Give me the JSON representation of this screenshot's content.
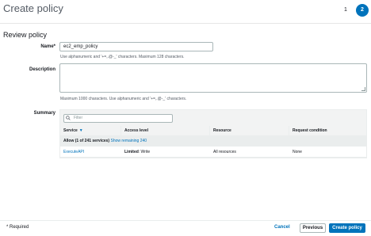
{
  "header": {
    "title": "Create policy",
    "steps": [
      "1",
      "2"
    ]
  },
  "review": {
    "section_title": "Review policy",
    "name_label": "Name*",
    "name_value": "ec2_emp_policy",
    "name_hint": "Use alphanumeric and '+=,.@-_' characters. Maximum 128 characters.",
    "description_label": "Description",
    "description_value": "",
    "description_hint": "Maximum 1000 characters. Use alphanumeric and '+=,.@-_' characters.",
    "summary_label": "Summary"
  },
  "summary": {
    "filter_placeholder": "Filter",
    "columns": [
      "Service",
      "Access level",
      "Resource",
      "Request condition"
    ],
    "group_text": "Allow (1 of 241 services)",
    "group_link": "Show remaining 240",
    "rows": [
      {
        "service": "ExecuteAPI",
        "access_level_bold": "Limited",
        "access_level_rest": ": Write",
        "resource": "All resources",
        "condition": "None"
      }
    ]
  },
  "footer": {
    "required": "* Required",
    "cancel": "Cancel",
    "previous": "Previous",
    "create": "Create policy"
  },
  "colors": {
    "accent": "#0073bb",
    "primary_button": "#0073bb"
  }
}
